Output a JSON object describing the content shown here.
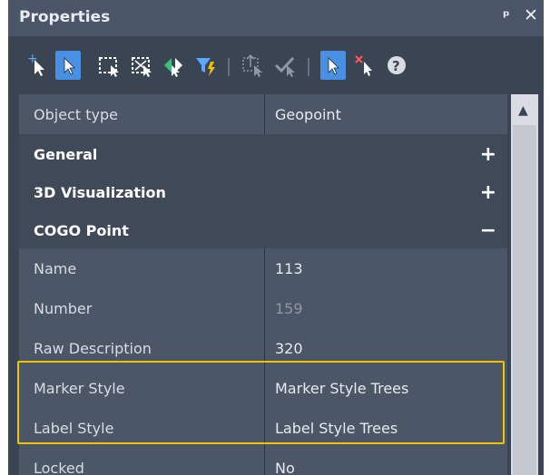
{
  "window": {
    "title": "Properties",
    "pin_glyph": "ᵖ",
    "close_glyph": "✕"
  },
  "toolbar": {
    "icons": [
      "add-pointer-icon",
      "select-pointer-icon",
      "select-window-icon",
      "select-crossing-icon",
      "select-group-icon",
      "filter-icon",
      "select-similar-icon",
      "apply-icon",
      "toggle-pickadd-icon",
      "remove-pointer-icon",
      "help-icon"
    ]
  },
  "grid": {
    "rows": [
      {
        "kind": "prop",
        "name": "Object type",
        "value": "Geopoint"
      },
      {
        "kind": "cat",
        "name": "General",
        "sign": "+"
      },
      {
        "kind": "cat",
        "name": "3D Visualization",
        "sign": "+"
      },
      {
        "kind": "cat",
        "name": "COGO Point",
        "sign": "−"
      },
      {
        "kind": "prop",
        "name": "Name",
        "value": "113"
      },
      {
        "kind": "prop",
        "name": "Number",
        "value": "159",
        "dim": true
      },
      {
        "kind": "prop",
        "name": "Raw Description",
        "value": "320"
      },
      {
        "kind": "prop",
        "name": "Marker Style",
        "value": "Marker Style Trees"
      },
      {
        "kind": "prop",
        "name": "Label Style",
        "value": "Label Style Trees"
      },
      {
        "kind": "prop",
        "name": "Locked",
        "value": "No"
      }
    ]
  },
  "colors": {
    "panel_bg": "#3b4453",
    "highlight": "#f2c200",
    "selected_tool": "#4a90e2"
  }
}
